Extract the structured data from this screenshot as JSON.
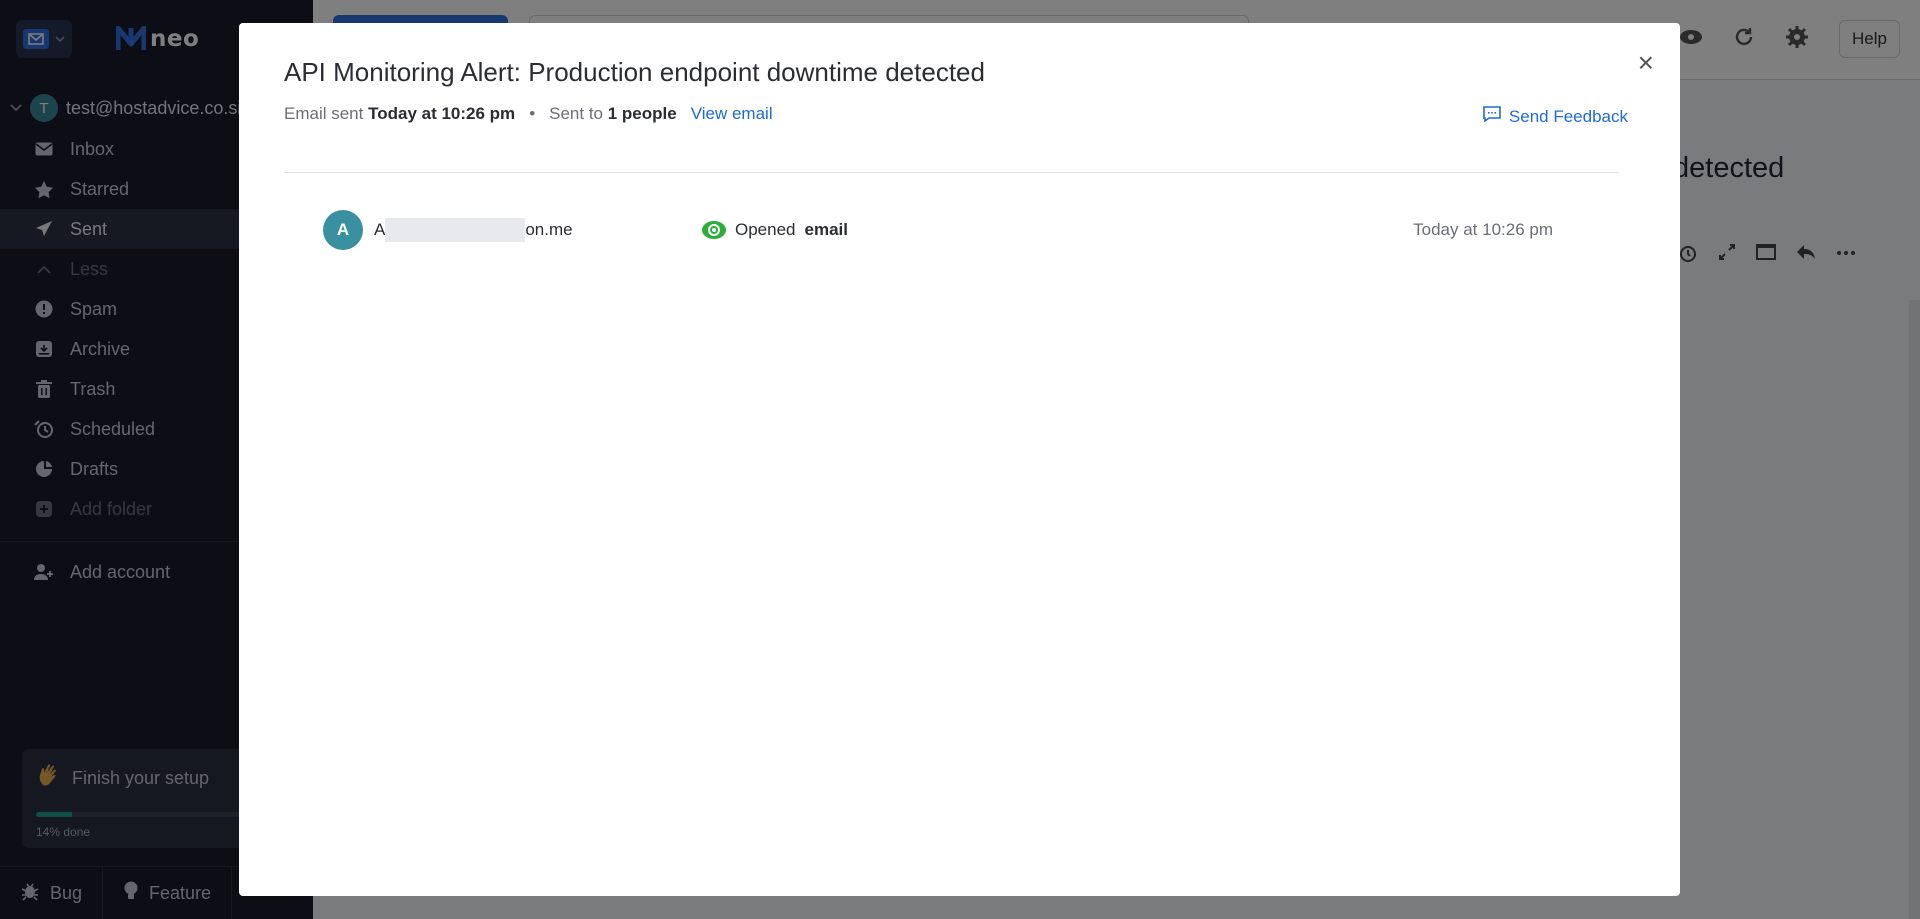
{
  "app": {
    "logo_text": "neo",
    "account_initial": "T",
    "account_email": "test@hostadvice.co.si"
  },
  "sidebar": {
    "items": [
      {
        "label": "Inbox",
        "icon": "envelope-icon"
      },
      {
        "label": "Starred",
        "icon": "star-icon"
      },
      {
        "label": "Sent",
        "icon": "paper-plane-icon",
        "active": true
      },
      {
        "label": "Less",
        "icon": "chevron-up-icon",
        "dim": true
      },
      {
        "label": "Spam",
        "icon": "alert-icon"
      },
      {
        "label": "Archive",
        "icon": "archive-icon"
      },
      {
        "label": "Trash",
        "icon": "trash-icon"
      },
      {
        "label": "Scheduled",
        "icon": "clock-icon"
      },
      {
        "label": "Drafts",
        "icon": "draft-icon"
      },
      {
        "label": "Add folder",
        "icon": "plus-square-icon",
        "dim": true
      }
    ],
    "add_account": "Add account",
    "setup": {
      "title": "Finish your setup",
      "progress": 0.14,
      "progress_label": "14% done"
    },
    "bottom": {
      "bug": "Bug",
      "feature": "Feature"
    }
  },
  "topbar": {
    "help": "Help"
  },
  "background": {
    "subject_fragment": "detected"
  },
  "modal": {
    "title": "API Monitoring Alert: Production endpoint downtime detected",
    "meta": {
      "sent_prefix": "Email sent",
      "sent_time": "Today at 10:26 pm",
      "to_prefix": "Sent to",
      "to_count": "1 people",
      "view_email": "View email"
    },
    "feedback": "Send Feedback",
    "close": "×",
    "recipients": [
      {
        "initial": "A",
        "email_start": "A",
        "email_end": "on.me",
        "status_prefix": "Opened",
        "status_bold": "email",
        "time": "Today at 10:26 pm"
      }
    ]
  },
  "colors": {
    "accent": "#1e6bd6",
    "opened": "#2fae3c",
    "sidebar_bg": "#1a1c2b"
  }
}
